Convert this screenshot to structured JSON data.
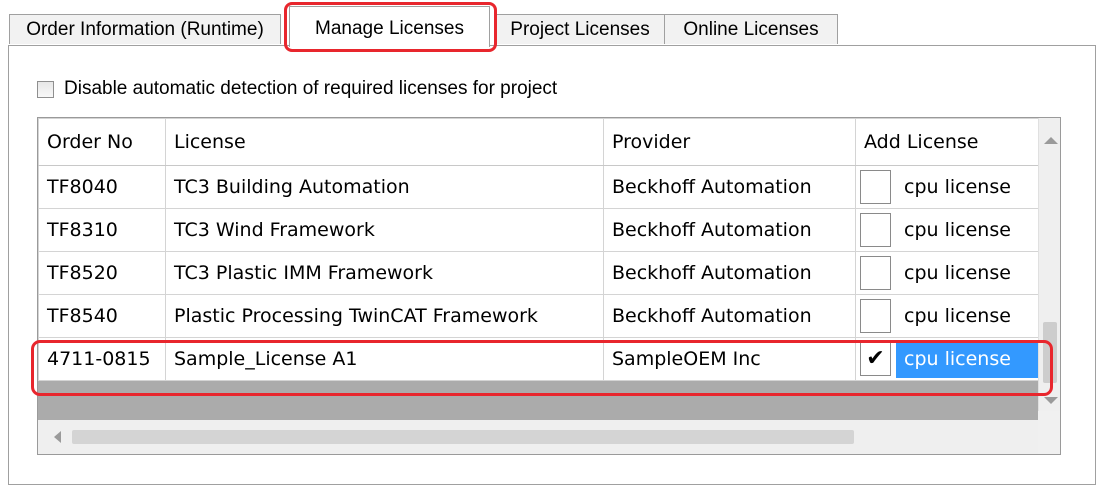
{
  "tabs": [
    {
      "label": "Order Information (Runtime)",
      "active": false
    },
    {
      "label": "Manage Licenses",
      "active": true
    },
    {
      "label": "Project Licenses",
      "active": false
    },
    {
      "label": "Online Licenses",
      "active": false
    }
  ],
  "option": {
    "label": "Disable automatic detection of required licenses for project",
    "checked": false
  },
  "grid": {
    "columns": [
      "Order No",
      "License",
      "Provider",
      "Add License"
    ],
    "rows": [
      {
        "order_no": "TF8040",
        "license": "TC3 Building Automation",
        "provider": "Beckhoff Automation",
        "add_label": "cpu license",
        "checked": false
      },
      {
        "order_no": "TF8310",
        "license": "TC3 Wind Framework",
        "provider": "Beckhoff Automation",
        "add_label": "cpu license",
        "checked": false
      },
      {
        "order_no": "TF8520",
        "license": "TC3 Plastic IMM Framework",
        "provider": "Beckhoff Automation",
        "add_label": "cpu license",
        "checked": false
      },
      {
        "order_no": "TF8540",
        "license": "Plastic Processing TwinCAT Framework",
        "provider": "Beckhoff Automation",
        "add_label": "cpu license",
        "checked": false
      },
      {
        "order_no": "4711-0815",
        "license": "Sample_License A1",
        "provider": "SampleOEM Inc",
        "add_label": "cpu license",
        "checked": true
      }
    ],
    "checkmark": "✔"
  },
  "colors": {
    "highlight": "#e8262d",
    "selection": "#3399ff"
  },
  "icons": {
    "scroll_up": "scroll-up-arrow-icon",
    "scroll_down": "scroll-down-arrow-icon",
    "scroll_left": "scroll-left-arrow-icon"
  }
}
